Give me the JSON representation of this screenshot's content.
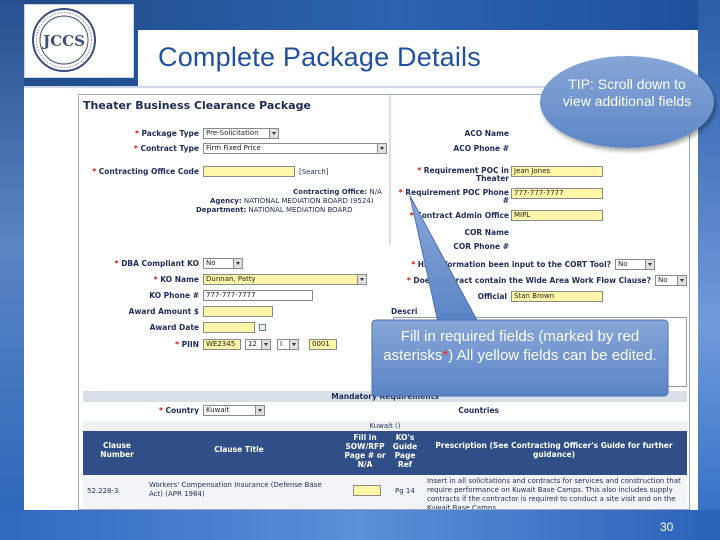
{
  "slide": {
    "title": "Complete Package Details",
    "page_number": "30",
    "logo_text": "JCCS",
    "colors": {
      "frame_blue": "#2b63b0",
      "title_blue": "#2150a0",
      "field_yellow": "#fff7a8",
      "table_header": "#2f4f86",
      "callout_blue": "#6e93cf"
    }
  },
  "tip_callout": {
    "text": "TIP: Scroll down to view additional fields"
  },
  "fill_callout": {
    "text_before": "Fill in required fields (marked by red asterisks",
    "asterisk": "*",
    "text_after": ") All yellow fields can be edited."
  },
  "form": {
    "title": "Theater Business Clearance Package",
    "left": {
      "package_type": {
        "label": "Package Type",
        "value": "Pre-Solicitation"
      },
      "contract_type": {
        "label": "Contract Type",
        "value": "Firm Fixed Price"
      },
      "contracting_office_code": {
        "label": "Contracting Office Code",
        "value": "",
        "button": "[Search]"
      },
      "contracting_office": {
        "label": "Contracting Office:",
        "value": "N/A"
      },
      "agency": {
        "label": "Agency:",
        "value": "NATIONAL MEDIATION BOARD (9524)"
      },
      "department": {
        "label": "Department:",
        "value": "NATIONAL MEDIATION BOARD"
      },
      "dba_compliant_ko": {
        "label": "DBA Compliant KO",
        "value": "No"
      },
      "ko_name": {
        "label": "KO Name",
        "value": "Dunnan, Patty"
      },
      "ko_phone": {
        "label": "KO Phone #",
        "value": "777-777-7777"
      },
      "award_amount": {
        "label": "Award Amount $",
        "value": ""
      },
      "award_date": {
        "label": "Award Date",
        "value": ""
      },
      "piin": {
        "label": "PIIN",
        "part1": "WE2345",
        "part2": "12",
        "part3": "I",
        "part4": "0001"
      }
    },
    "right": {
      "aco_name": {
        "label": "ACO Name",
        "value": ""
      },
      "aco_phone": {
        "label": "ACO Phone #",
        "value": ""
      },
      "requirement_poc": {
        "label": "Requirement POC in Theater",
        "value": "Jean Jones"
      },
      "requirement_poc_phone": {
        "label": "Requirement POC Phone #",
        "value": "777-777-7777"
      },
      "contract_admin_office": {
        "label": "Contract Admin Office",
        "value": "MIPL"
      },
      "cor_name": {
        "label": "COR Name",
        "value": ""
      },
      "cor_phone": {
        "label": "COR Phone #",
        "value": ""
      },
      "cort_tool": {
        "label": "Has information been input to the CORT Tool?",
        "value": "No"
      },
      "wawf": {
        "label": "Does contract contain the Wide Area Work Flow Clause?",
        "value": "No"
      },
      "official": {
        "label": "Official",
        "value": "Stan Brown"
      },
      "description_label": "Descri"
    },
    "mandatory_section": "Mandatory Requirements",
    "country": {
      "label": "Country",
      "value": "Kuwait"
    },
    "countries_label": "Countries",
    "kuwait_strip": "Kuwait ()",
    "table": {
      "headers": [
        "Clause Number",
        "Clause Title",
        "Fill in SOW/RFP Page # or N/A",
        "KO's Guide Page Ref",
        "Prescription (See Contracting Officer's Guide for further guidance)"
      ],
      "rows": [
        {
          "number": "52.228-3",
          "title": "Workers' Compensation Insurance (Defense Base Act) (APR 1984)",
          "fill": "",
          "guide": "Pg 14",
          "prescription": "Insert in all solicitations and contracts for services and construction that require performance on Kuwait Base Camps. This also includes supply contracts if the contractor is required to conduct a site visit and on the Kuwait Base Camps."
        }
      ]
    }
  }
}
